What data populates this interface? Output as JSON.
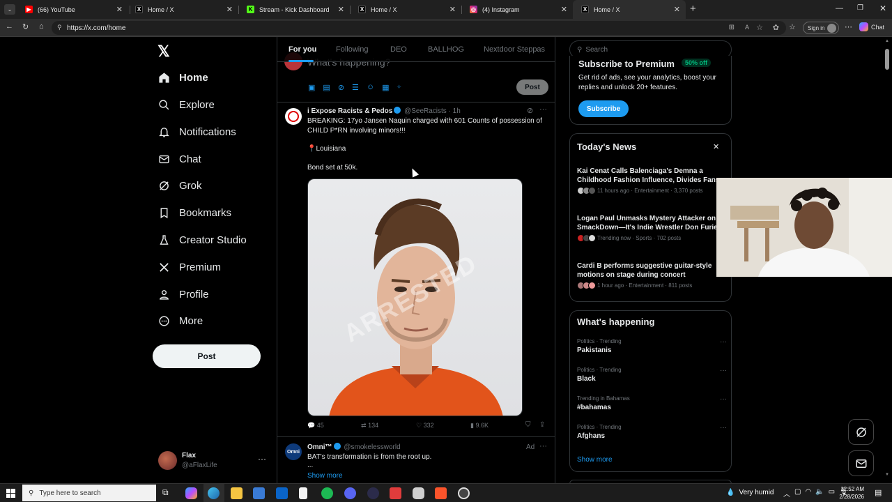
{
  "browser": {
    "tabs": [
      {
        "title": "(66) YouTube",
        "color": "#ff0000",
        "glyph": "▶"
      },
      {
        "title": "Home / X",
        "color": "#000000",
        "glyph": "X"
      },
      {
        "title": "Stream - Kick Dashboard",
        "color": "#53fc18",
        "glyph": "K"
      },
      {
        "title": "Home / X",
        "color": "#000000",
        "glyph": "X"
      },
      {
        "title": "(4) Instagram",
        "color": "#d62976",
        "glyph": "◎"
      },
      {
        "title": "Home / X",
        "color": "#000000",
        "glyph": "X"
      }
    ],
    "url": "https://x.com/home",
    "signin_label": "Sign in",
    "chat_label": "Chat"
  },
  "nav": {
    "items": [
      {
        "label": "Home",
        "icon": "home-icon"
      },
      {
        "label": "Explore",
        "icon": "search-icon"
      },
      {
        "label": "Notifications",
        "icon": "bell-icon"
      },
      {
        "label": "Chat",
        "icon": "mail-icon"
      },
      {
        "label": "Grok",
        "icon": "grok-icon"
      },
      {
        "label": "Bookmarks",
        "icon": "bookmark-icon"
      },
      {
        "label": "Creator Studio",
        "icon": "flask-icon"
      },
      {
        "label": "Premium",
        "icon": "x-icon"
      },
      {
        "label": "Profile",
        "icon": "person-icon"
      },
      {
        "label": "More",
        "icon": "more-circle-icon"
      }
    ],
    "post_label": "Post",
    "account": {
      "name": "Flax",
      "handle": "@aFlaxLife"
    }
  },
  "timeline": {
    "tabs": [
      "For you",
      "Following",
      "DEO",
      "BALLHOG",
      "Nextdoor Steppas"
    ],
    "composer": {
      "placeholder": "What's happening?",
      "post_label": "Post"
    },
    "tweet1": {
      "author": "i Expose Racists & Pedos",
      "handle": "@SeeRacists",
      "time": "· 1h",
      "text": "BREAKING: 17yo Jansen Naquin charged with 601 Counts of possession of CHILD P*RN involving minors!!!",
      "location": "Louisiana",
      "bond": "Bond set at 50k.",
      "watermark": "ARRESTED",
      "replies": "45",
      "reposts": "134",
      "likes": "332",
      "views": "9.6K"
    },
    "tweet2": {
      "author": "Omni™",
      "handle": "@smokelessworld",
      "ad": "Ad",
      "text": "BAT's transformation is from the root up.",
      "ellipsis": "...",
      "show_more": "Show more"
    }
  },
  "sidebar": {
    "search_placeholder": "Search",
    "premium": {
      "title": "Subscribe to Premium",
      "badge": "50% off",
      "desc": "Get rid of ads, see your analytics, boost your replies and unlock 20+ features.",
      "button": "Subscribe"
    },
    "news": {
      "title": "Today's News",
      "items": [
        {
          "title": "Kai Cenat Calls Balenciaga's Demna a Childhood Fashion Influence, Divides Fans",
          "meta": "11 hours ago · Entertainment · 3,370 posts"
        },
        {
          "title": "Logan Paul Unmasks Mystery Attacker on SmackDown—It's Indie Wrestler Don Furie",
          "meta": "Trending now · Sports · 702 posts"
        },
        {
          "title": "Cardi B performs suggestive guitar-style motions on stage during concert",
          "meta": "1 hour ago · Entertainment · 811 posts"
        }
      ]
    },
    "happening": {
      "title": "What's happening",
      "trends": [
        {
          "cat": "Politics · Trending",
          "name": "Pakistanis"
        },
        {
          "cat": "Politics · Trending",
          "name": "Black"
        },
        {
          "cat": "Trending in Bahamas",
          "name": "#bahamas"
        },
        {
          "cat": "Politics · Trending",
          "name": "Afghans"
        }
      ],
      "show_more": "Show more"
    }
  },
  "taskbar": {
    "search_placeholder": "Type here to search",
    "weather": "Very humid",
    "time": "12:52 AM",
    "date": "2/28/2026"
  }
}
